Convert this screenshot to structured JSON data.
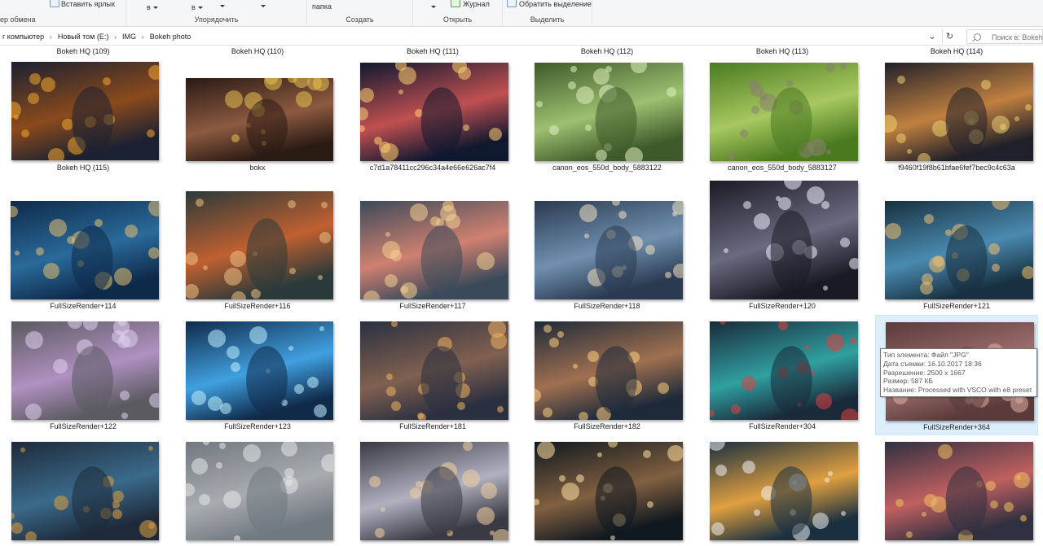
{
  "ribbon": {
    "clipboard": {
      "caption": "ер обмена",
      "paste_shortcut": "Вставить ярлык"
    },
    "organize": {
      "caption": "Упорядочить",
      "move_partial": "в",
      "copy_partial": "в"
    },
    "new": {
      "folder_label": "папка",
      "caption": "Создать"
    },
    "open": {
      "journal": "Журнал",
      "caption": "Открыть"
    },
    "select": {
      "invert": "Обратить выделение",
      "caption": "Выделить"
    }
  },
  "address": {
    "breadcrumbs": [
      "г компьютер",
      "Новый том (E:)",
      "IMG",
      "Bokeh photo"
    ],
    "search_placeholder": "Поиск в: Bokeh"
  },
  "top_row_labels": [
    "Bokeh HQ (109)",
    "Bokeh HQ (110)",
    "Bokeh HQ (111)",
    "Bokeh HQ (112)",
    "Bokeh HQ (113)",
    "Bokeh HQ (114)"
  ],
  "files": [
    {
      "name": "Bokeh HQ (115)",
      "palette": [
        "#1b2032",
        "#8a4a1c",
        "#f3a830"
      ]
    },
    {
      "name": "bokx",
      "palette": [
        "#2a1a14",
        "#8c5a40",
        "#e8c050"
      ]
    },
    {
      "name": "c7d1a78411cc296c34a4e66e626ac7f4",
      "palette": [
        "#101830",
        "#c05050",
        "#ffd070"
      ]
    },
    {
      "name": "canon_eos_550d_body_5883122",
      "palette": [
        "#3e5a2a",
        "#9cc070",
        "#e0eec0"
      ]
    },
    {
      "name": "canon_eos_550d_body_5883127",
      "palette": [
        "#4a7a20",
        "#a8c860",
        "#8a8070"
      ]
    },
    {
      "name": "f9460f19f8b61bfae6fef7bec9c4c63a",
      "palette": [
        "#20202a",
        "#c08040",
        "#f0d070"
      ]
    },
    {
      "name": "FullSizeRender+114",
      "palette": [
        "#0e2a4a",
        "#2a6a9a",
        "#e8c070"
      ]
    },
    {
      "name": "FullSizeRender+116",
      "palette": [
        "#2a3a3a",
        "#c06030",
        "#f0c080"
      ]
    },
    {
      "name": "FullSizeRender+117",
      "palette": [
        "#3a4a5a",
        "#d08070",
        "#f4d090"
      ]
    },
    {
      "name": "FullSizeRender+118",
      "palette": [
        "#2a3a50",
        "#7090b0",
        "#f0e0c0"
      ]
    },
    {
      "name": "FullSizeRender+120",
      "palette": [
        "#1a1a24",
        "#6a6a80",
        "#f0f0ff"
      ]
    },
    {
      "name": "FullSizeRender+121",
      "palette": [
        "#183040",
        "#4a8ab0",
        "#f0c070"
      ]
    },
    {
      "name": "FullSizeRender+122",
      "palette": [
        "#5a5a60",
        "#b090c0",
        "#e0d0f0"
      ]
    },
    {
      "name": "FullSizeRender+123",
      "palette": [
        "#102a4a",
        "#40a0e0",
        "#c0f0ff"
      ]
    },
    {
      "name": "FullSizeRender+181",
      "palette": [
        "#2a3040",
        "#806050",
        "#f0b060"
      ]
    },
    {
      "name": "FullSizeRender+182",
      "palette": [
        "#1e2a3a",
        "#a07050",
        "#ffd080"
      ]
    },
    {
      "name": "FullSizeRender+304",
      "palette": [
        "#1a2a3a",
        "#30a0a0",
        "#e04040"
      ]
    },
    {
      "name": "FullSizeRender+364",
      "palette": [
        "#5a3a3a",
        "#a07070",
        "#e0b0a0"
      ]
    },
    {
      "name": "",
      "palette": [
        "#1e2a3a",
        "#3a6a8a",
        "#e0a040"
      ]
    },
    {
      "name": "",
      "palette": [
        "#707880",
        "#a8acb0",
        "#e8e8e8"
      ]
    },
    {
      "name": "",
      "palette": [
        "#3a3a44",
        "#b0b0c0",
        "#f0d0a0"
      ]
    },
    {
      "name": "",
      "palette": [
        "#101820",
        "#806040",
        "#ffe0a0"
      ]
    },
    {
      "name": "",
      "palette": [
        "#1a3040",
        "#e0a040",
        "#f0f0f0"
      ]
    },
    {
      "name": "",
      "palette": [
        "#303040",
        "#c06060",
        "#f0c060"
      ]
    }
  ],
  "tooltip": {
    "lines": [
      "Тип элемента: Файл \"JPG\"",
      "Дата съемки: 16.10.2017 18:36",
      "Разрешение: 2500 x 1667",
      "Размер: 587 КБ",
      "Название: Processed with VSCO with e8 preset"
    ]
  }
}
